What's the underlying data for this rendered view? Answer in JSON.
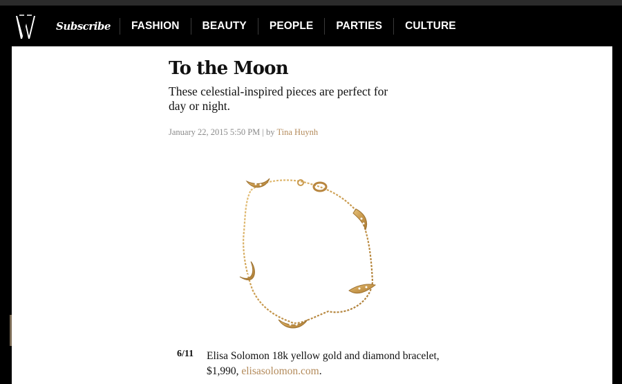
{
  "header": {
    "logo_text": "W",
    "subscribe_label": "Subscribe",
    "nav_items": [
      {
        "label": "FASHION"
      },
      {
        "label": "BEAUTY"
      },
      {
        "label": "PEOPLE"
      },
      {
        "label": "PARTIES"
      },
      {
        "label": "CULTURE"
      }
    ]
  },
  "article": {
    "title": "To the Moon",
    "subtitle": "These celestial-inspired pieces are perfect for day or night.",
    "date": "January 22, 2015 5:50 PM",
    "by_separator": "| by",
    "author": "Tina Huynh"
  },
  "slide": {
    "counter_current": "6",
    "counter_total": "11",
    "caption_text": "Elisa Solomon 18k yellow gold and diamond bracelet, $1,990,",
    "caption_link": "elisasolomon.com",
    "caption_end": "."
  },
  "colors": {
    "header_bg": "#000000",
    "link_gold": "#b38a5a",
    "meta_gray": "#8a8a8a"
  }
}
